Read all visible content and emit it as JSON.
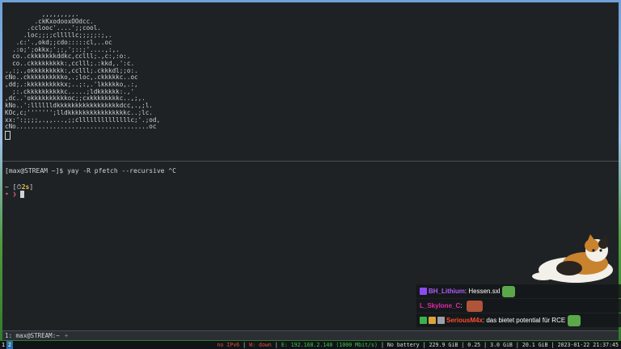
{
  "ascii_logo": [
    "          ,,,,,,,,,.",
    "        .ckKxodooxOOdcc.",
    "      .cclooc'....';;cool.",
    "     .loc;;;;clllllc;;;;;:;,.",
    "   .c:'.,okd;;cdo:::::cl,..oc",
    "  .:o;';okkx;';;,';::;'....,:,.",
    "  co..ckkkkkkkddkc,cclll;.,c:,:o:.",
    "  co..ckkkkkkkkk:,cclll;.:kkd,.':c.",
    ".,:;.,okkkkkkkkk:,cclll;.ckkkdl;;o:.",
    "cNo..ckkkkkkkkkko,.;loc,.ckkkkkc..oc",
    ",dd;.:kkkkkkkkkkx;..;:,.'lkkkkko,.:,",
    "  ;:.ckkkkkkkkkkc.....;ldkkkkkk:.,'",
    ",dc..'okkkkkkkkkkoc;;cxkkkkkkkkc..,;,.",
    "kNo..':lllllldkkkkkkkkkkkkkkkkkdcc,.,;l.",
    "KOc,c;''''''';lldkkkkkkkkkkkkkkkkc..;lc.",
    "xx:':;;;;,.,,...,;;cllllllllllllllc;'.;od,",
    "cNo....................................oc"
  ],
  "terminal": {
    "command_line": "[max@STREAM ~]$ yay -R pfetch --recursive ^C",
    "prompt_prefix": "~ [",
    "duration": "2s",
    "prompt_suffix": "]",
    "prompt_arrow": "• ❯"
  },
  "tmux": {
    "window_label": "1: max@STREAM:~",
    "new_window": "+"
  },
  "chat": [
    {
      "user": "BH_Lithium",
      "message": "Hessen.sxl",
      "user_color": "#b05cff"
    },
    {
      "user": "L_Skylone_C",
      "message": "",
      "user_color": "#e02aa6"
    },
    {
      "user": "SeriousM4x",
      "message": "das bietet potential für RCE",
      "user_color": "#ff4d2e"
    }
  ],
  "sysbar": {
    "workspaces": [
      "1",
      "2"
    ],
    "ipv6": "no IPv6",
    "wifi": "down",
    "ethernet": "E: 192.168.2.140 (1000 Mbit/s)",
    "battery": "No battery",
    "disk": "229.9 GiB",
    "load": "0.25",
    "mem": "3.0 GiB",
    "disk2": "20.1 GiB",
    "datetime": "2023-01-22 21:37:45"
  },
  "colors": {
    "terminal_bg": "#1f2225",
    "accent_yellow": "#e7c547",
    "accent_red": "#e04a3f",
    "accent_green": "#43c153"
  }
}
